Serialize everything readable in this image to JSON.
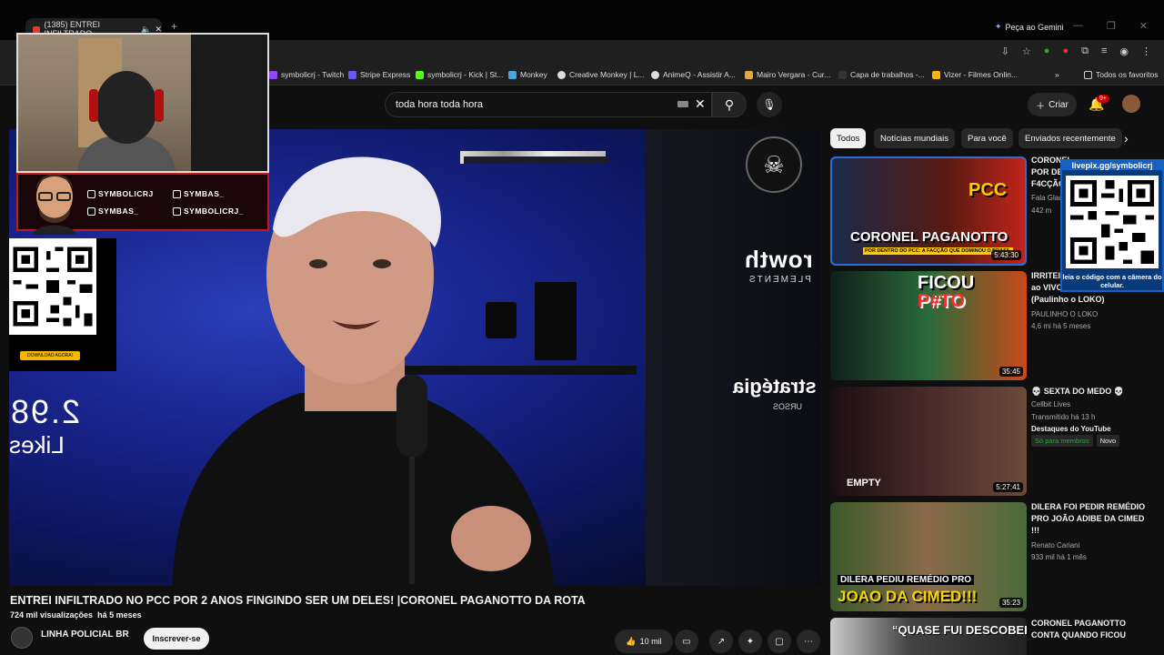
{
  "browser": {
    "tab_title": "(1385) ENTREI INFILTRADO",
    "gemini_label": "Peça ao Gemini",
    "bookmarks": [
      "symbolicrj - Twitch",
      "Stripe Express",
      "symbolicrj - Kick | St...",
      "Monkey",
      "Creative Monkey | L...",
      "AnimeQ - Assistir A...",
      "Mairo Vergara - Cur...",
      "Capa de trabalhos -...",
      "Vizer - Filmes Onlin..."
    ],
    "bookmarks_more": "»",
    "all_bookmarks": "Todos os favoritos"
  },
  "header": {
    "search_value": "toda hora toda hora",
    "create_label": "Criar",
    "notification_badge": "9+"
  },
  "player": {
    "likes_number": "2.98",
    "likes_label": "Likes",
    "wall_text_1": "rowth",
    "wall_text_1_sub": "PLEMENTS",
    "wall_text_2": "stratégia",
    "wall_text_2_sub": "URSOS"
  },
  "overlay": {
    "social": [
      "SYMBOLICRJ",
      "SYMBAS_",
      "SYMBAS_",
      "SYMBOLICRJ_"
    ],
    "qr_left_button": "DOWNLOAD AGORA!",
    "qr_right_url": "livepix.gg/symbolicrj",
    "qr_right_caption": "leia o código com a câmera do celular."
  },
  "video": {
    "title": "ENTREI INFILTRADO NO PCC POR 2 ANOS FINGINDO SER UM DELES! |CORONEL PAGANOTTO DA ROTA",
    "views": "724 mil visualizações",
    "age": "há 5 meses",
    "channel": "LINHA POLICIAL BR",
    "subscribe": "Inscrever-se",
    "likes": "10 mil"
  },
  "chips": [
    "Todos",
    "Notícias mundiais",
    "Para você",
    "Enviados recentemente"
  ],
  "sidebar": [
    {
      "title_lines": [
        "CORONEL",
        "POR DE",
        "F4CÇÃO"
      ],
      "channel": "Fala Glau",
      "meta": "442 m",
      "duration": "5:43:30",
      "thumb_caption": "CORONEL PAGANOTTO",
      "thumb_sub": "POR DENTRO DO PCC: A FACÇÃO QUE DOMINOU O BRASIL",
      "thumb_badge": "PCC"
    },
    {
      "title_lines": [
        "IRRITEI",
        "ao VIVO",
        "(Paulinho o LOKO)"
      ],
      "channel": "PAULINHO O LOKO",
      "meta": "4,6 mi  há 5 meses",
      "duration": "35:45",
      "thumb_caption": "FICOU",
      "thumb_sub": "P#TO"
    },
    {
      "title_lines": [
        "💀 SEXTA DO MEDO 💀"
      ],
      "channel": "Cellbit Lives",
      "meta": "Transmitido há 13 h",
      "extra": "Destaques do YouTube",
      "badge_members": "Só para membros",
      "badge_new": "Novo",
      "duration": "5:27:41",
      "thumb_caption": "EMPTY"
    },
    {
      "title_lines": [
        "DILERA FOI PEDIR REMÉDIO",
        "PRO JOÃO ADIBE DA CIMED",
        "!!!"
      ],
      "channel": "Renato Cariani",
      "meta": "933 mil  há 1 mês",
      "duration": "35:23",
      "thumb_caption": "DILERA PEDIU REMÉDIO PRO",
      "thumb_sub": "JOAO DA CIMED!!!"
    },
    {
      "title_lines": [
        "CORONEL PAGANOTTO",
        "CONTA QUANDO FICOU"
      ],
      "thumb_caption": "“QUASE FUI DESCOBERTO"
    }
  ],
  "colors": {
    "accent_red": "#cc0000",
    "player_blue": "#1a2690",
    "thumb_yellow": "#f5d400"
  }
}
